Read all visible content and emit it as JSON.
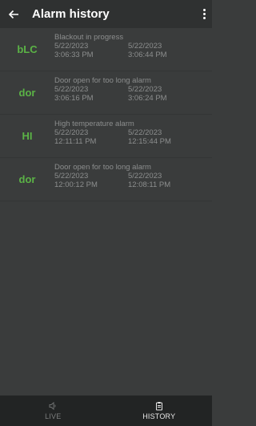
{
  "header": {
    "title": "Alarm history",
    "back_icon": "arrow-left-icon",
    "menu_icon": "more-vertical-icon"
  },
  "alarms": [
    {
      "code": "bLC",
      "description": "Blackout in progress",
      "start_date": "5/22/2023",
      "start_time": "3:06:33 PM",
      "end_date": "5/22/2023",
      "end_time": "3:06:44 PM"
    },
    {
      "code": "dor",
      "description": "Door open for too long alarm",
      "start_date": "5/22/2023",
      "start_time": "3:06:16 PM",
      "end_date": "5/22/2023",
      "end_time": "3:06:24 PM"
    },
    {
      "code": "HI",
      "description": "High temperature alarm",
      "start_date": "5/22/2023",
      "start_time": "12:11:11 PM",
      "end_date": "5/22/2023",
      "end_time": "12:15:44 PM"
    },
    {
      "code": "dor",
      "description": "Door open for too long alarm",
      "start_date": "5/22/2023",
      "start_time": "12:00:12 PM",
      "end_date": "5/22/2023",
      "end_time": "12:08:11 PM"
    }
  ],
  "nav": {
    "live_label": "LIVE",
    "live_icon": "speaker-icon",
    "history_label": "HISTORY",
    "history_icon": "clipboard-icon"
  },
  "colors": {
    "code_green": "#5bb346",
    "background": "#3a3c3c",
    "app_bar": "#2f3131",
    "bottom_nav": "#222424"
  }
}
